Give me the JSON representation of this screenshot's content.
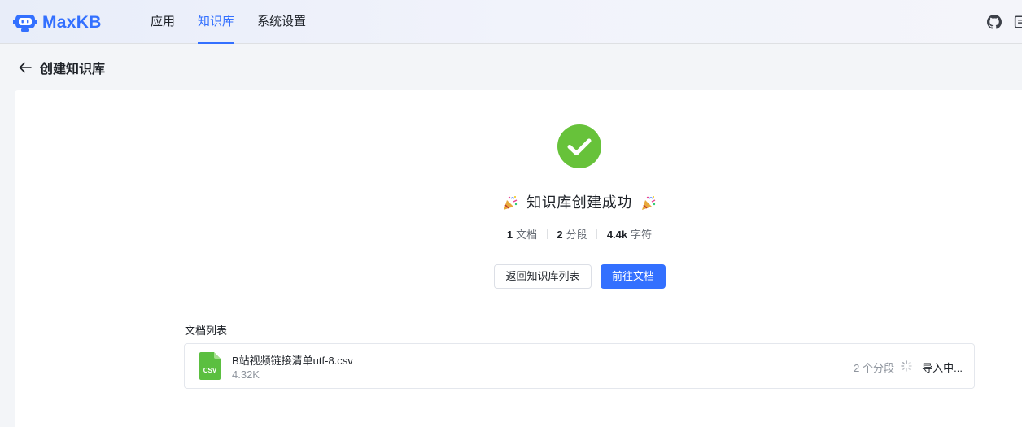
{
  "app": {
    "name": "MaxKB"
  },
  "nav": [
    {
      "label": "应用",
      "active": false
    },
    {
      "label": "知识库",
      "active": true
    },
    {
      "label": "系统设置",
      "active": false
    }
  ],
  "header_icons": [
    "github-icon",
    "document-icon"
  ],
  "page": {
    "title": "创建知识库"
  },
  "success": {
    "title": "知识库创建成功",
    "stats": [
      {
        "value": "1",
        "label": "文档"
      },
      {
        "value": "2",
        "label": "分段"
      },
      {
        "value": "4.4k",
        "label": "字符"
      }
    ]
  },
  "actions": {
    "back_label": "返回知识库列表",
    "go_label": "前往文档"
  },
  "doc_list": {
    "label": "文档列表",
    "items": [
      {
        "file_type": "CSV",
        "name": "B站视频链接清单utf-8.csv",
        "size": "4.32K",
        "segments": "2 个分段",
        "status": "导入中..."
      }
    ]
  },
  "colors": {
    "accent": "#3370ff",
    "success": "#67c23a",
    "csv": "#5bbf40"
  }
}
